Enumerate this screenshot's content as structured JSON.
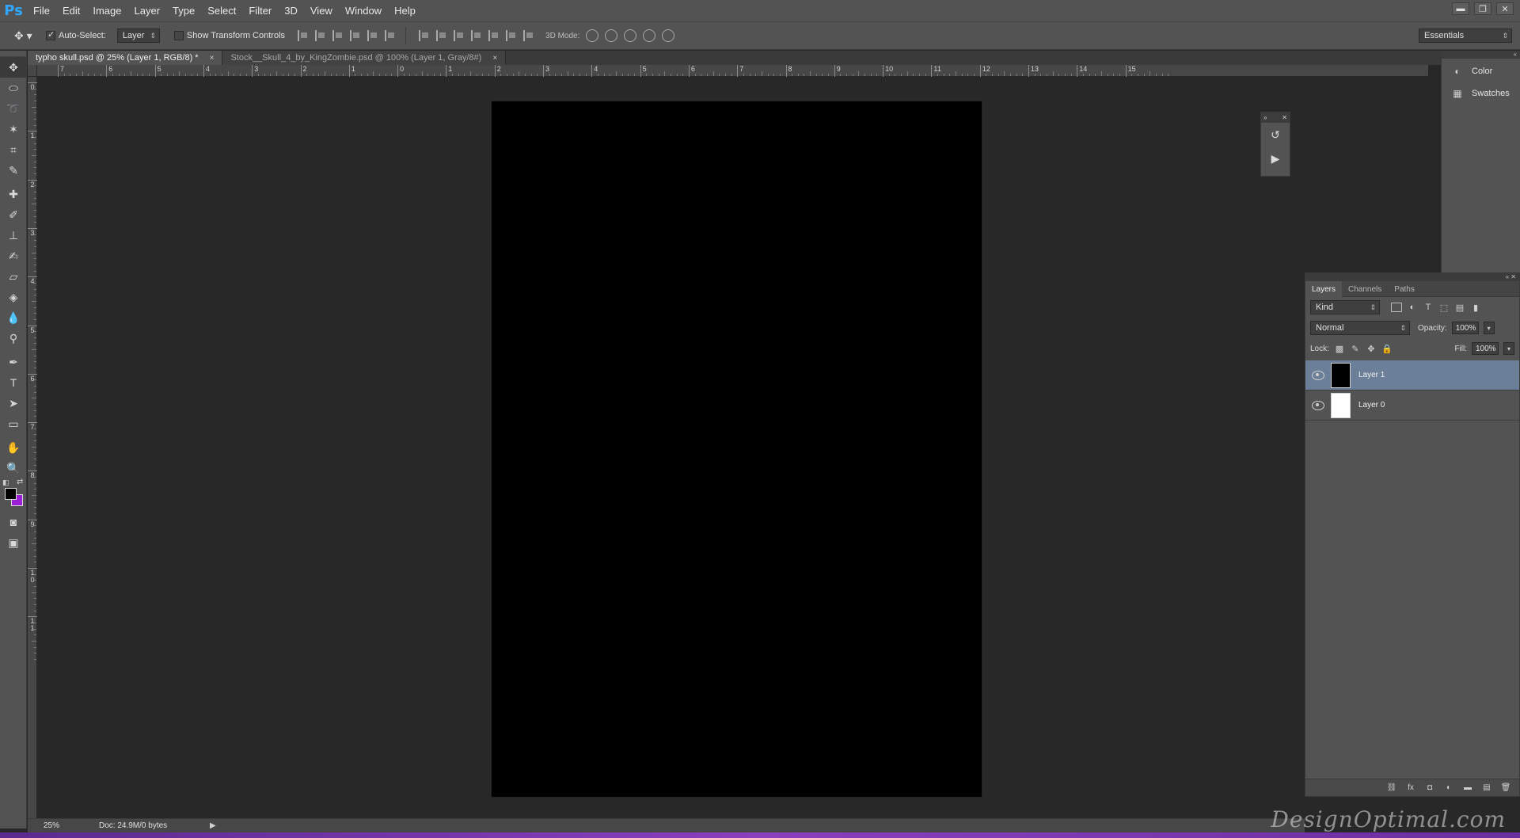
{
  "app": {
    "logo": "Ps"
  },
  "menu": [
    "File",
    "Edit",
    "Image",
    "Layer",
    "Type",
    "Select",
    "Filter",
    "3D",
    "View",
    "Window",
    "Help"
  ],
  "window_controls": {
    "minimize": "▬",
    "restore": "❐",
    "close": "✕"
  },
  "options": {
    "auto_select_label": "Auto-Select:",
    "auto_select_checked": true,
    "auto_select_target": "Layer",
    "show_transform_label": "Show Transform Controls",
    "show_transform_checked": false,
    "mode3d_label": "3D Mode:",
    "workspace": "Essentials"
  },
  "tabs": [
    {
      "label": "typho skull.psd @ 25% (Layer 1, RGB/8) *",
      "active": true
    },
    {
      "label": "Stock__Skull_4_by_KingZombie.psd @ 100% (Layer 1, Gray/8#)",
      "active": false
    }
  ],
  "tab_close": "×",
  "ruler_h": [
    "7",
    "6",
    "5",
    "4",
    "3",
    "2",
    "1",
    "0",
    "1",
    "2",
    "3",
    "4",
    "5",
    "6",
    "7",
    "8",
    "9",
    "10",
    "11",
    "12",
    "13",
    "14",
    "15"
  ],
  "ruler_v": [
    "0",
    "1",
    "2",
    "3",
    "4",
    "5",
    "6",
    "7",
    "8",
    "9",
    "1 0",
    "1 1"
  ],
  "colors": {
    "foreground": "#000000",
    "background": "#9a1fd6",
    "selection": "#6b7f99"
  },
  "right_dock": [
    {
      "label": "Color",
      "icon": "color-icon"
    },
    {
      "label": "Swatches",
      "icon": "swatches-icon"
    }
  ],
  "layers_panel": {
    "tabs": [
      "Layers",
      "Channels",
      "Paths"
    ],
    "filter_kind": "Kind",
    "blend_mode": "Normal",
    "opacity_label": "Opacity:",
    "opacity": "100%",
    "lock_label": "Lock:",
    "fill_label": "Fill:",
    "fill": "100%",
    "layers": [
      {
        "name": "Layer 1",
        "thumb": "#000000",
        "selected": true
      },
      {
        "name": "Layer 0",
        "thumb": "#ffffff",
        "selected": false
      }
    ]
  },
  "status": {
    "zoom": "25%",
    "doc_size": "Doc: 24.9M/0 bytes"
  },
  "watermark": "DesignOptimal.com"
}
